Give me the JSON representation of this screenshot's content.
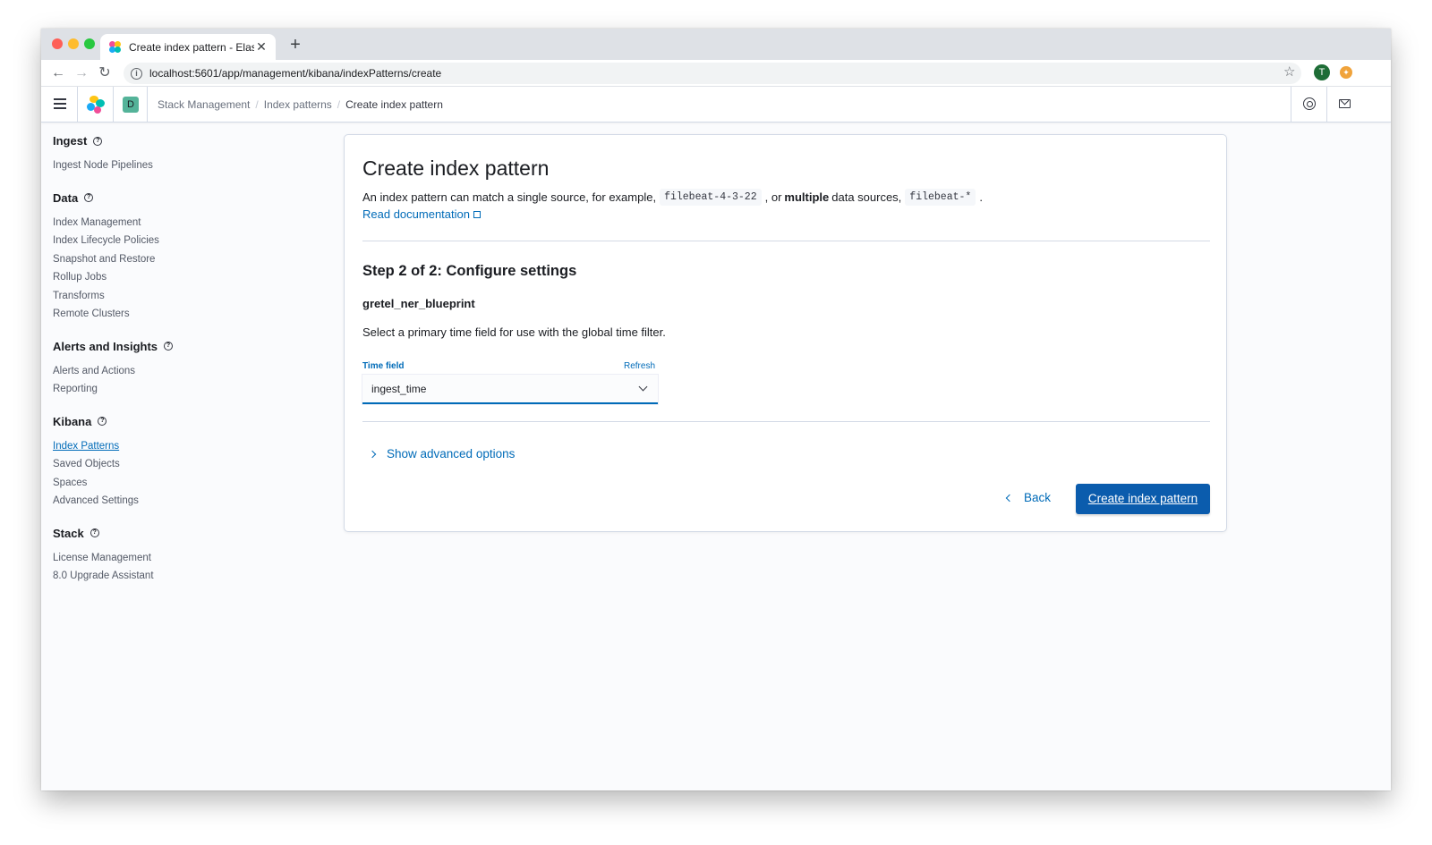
{
  "browser": {
    "tab_title": "Create index pattern - Elastic",
    "tab_close": "✕",
    "new_tab": "+",
    "url": "localhost:5601/app/management/kibana/indexPatterns/create",
    "profile_initial": "T"
  },
  "header": {
    "space_initial": "D",
    "breadcrumbs": [
      "Stack Management",
      "Index patterns",
      "Create index pattern"
    ]
  },
  "sidenav": {
    "groups": [
      {
        "title": "Ingest",
        "items": [
          "Ingest Node Pipelines"
        ]
      },
      {
        "title": "Data",
        "items": [
          "Index Management",
          "Index Lifecycle Policies",
          "Snapshot and Restore",
          "Rollup Jobs",
          "Transforms",
          "Remote Clusters"
        ]
      },
      {
        "title": "Alerts and Insights",
        "items": [
          "Alerts and Actions",
          "Reporting"
        ]
      },
      {
        "title": "Kibana",
        "items": [
          "Index Patterns",
          "Saved Objects",
          "Spaces",
          "Advanced Settings"
        ],
        "active_item": "Index Patterns"
      },
      {
        "title": "Stack",
        "items": [
          "License Management",
          "8.0 Upgrade Assistant"
        ]
      }
    ]
  },
  "panel": {
    "title": "Create index pattern",
    "description_part1": "An index pattern can match a single source, for example,",
    "example_single": "filebeat-4-3-22",
    "description_part2": ", or",
    "description_bold": "multiple",
    "description_part3": "data sources,",
    "example_multiple": "filebeat-*",
    "description_end": ".",
    "doc_link": "Read documentation",
    "step_title": "Step 2 of 2: Configure settings",
    "pattern_name": "gretel_ner_blueprint",
    "instruction": "Select a primary time field for use with the global time filter.",
    "time_field_label": "Time field",
    "refresh_label": "Refresh",
    "time_field_value": "ingest_time",
    "advanced_toggle": "Show advanced options",
    "back_label": "Back",
    "create_label": "Create index pattern"
  },
  "colors": {
    "primary": "#006bb8",
    "button": "#0b5cad",
    "space_avatar": "#54b399"
  }
}
